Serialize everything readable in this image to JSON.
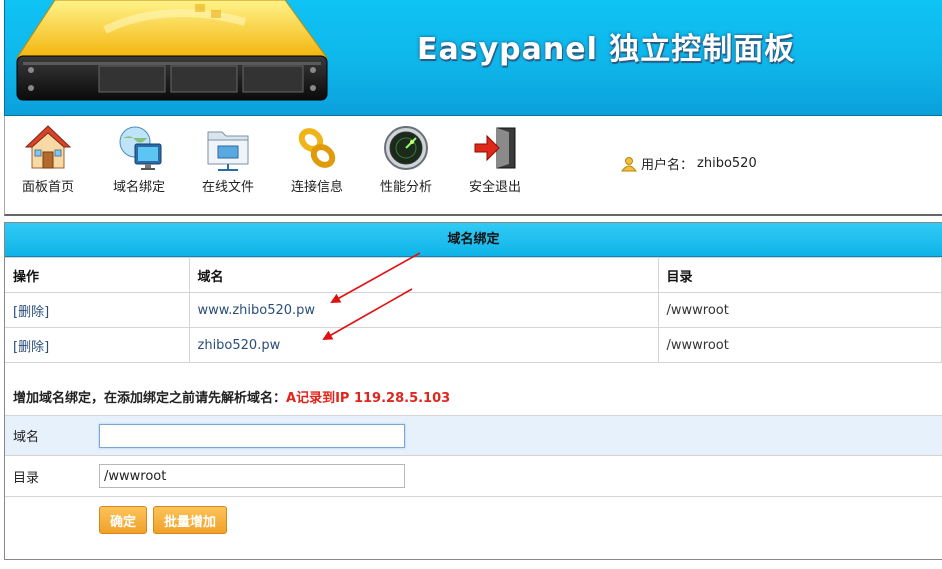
{
  "banner": {
    "title": "Easypanel 独立控制面板"
  },
  "nav": {
    "items": [
      {
        "label": "面板首页",
        "icon": "home-icon"
      },
      {
        "label": "域名绑定",
        "icon": "globe-monitor-icon"
      },
      {
        "label": "在线文件",
        "icon": "folder-network-icon"
      },
      {
        "label": "连接信息",
        "icon": "chain-link-icon"
      },
      {
        "label": "性能分析",
        "icon": "radar-icon"
      },
      {
        "label": "安全退出",
        "icon": "exit-door-icon"
      }
    ]
  },
  "user": {
    "label": "用户名：",
    "name": "zhibo520"
  },
  "domains": {
    "title": "域名绑定",
    "headers": [
      "操作",
      "域名",
      "目录"
    ],
    "rows": [
      {
        "action": "[删除]",
        "domain": "www.zhibo520.pw",
        "dir": "/wwwroot"
      },
      {
        "action": "[删除]",
        "domain": "zhibo520.pw",
        "dir": "/wwwroot"
      }
    ]
  },
  "add_form": {
    "notice": "增加域名绑定，在添加绑定之前请先解析域名：",
    "notice_highlight": "A记录到IP 119.28.5.103",
    "domain_label": "域名",
    "domain_value": "",
    "dir_label": "目录",
    "dir_value": "/wwwroot",
    "submit_label": "确定",
    "batch_label": "批量增加"
  },
  "colors": {
    "banner_blue": "#0fb6ea",
    "highlight_red": "#e0261c",
    "button_orange": "#f0a12a",
    "link_blue": "#2a4d7c"
  }
}
